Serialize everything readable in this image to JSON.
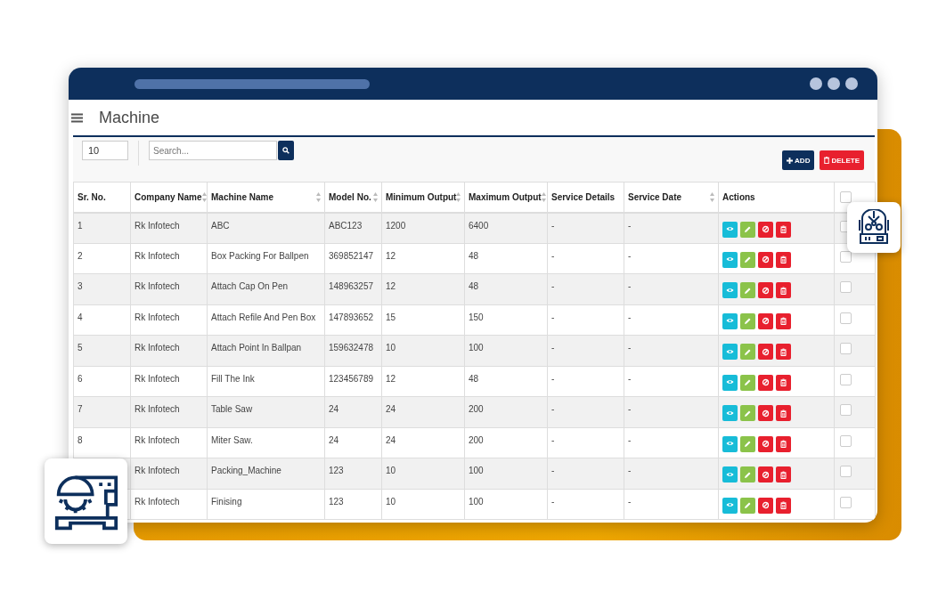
{
  "window": {
    "title": "Machine"
  },
  "toolbar": {
    "page_size": "10",
    "search": {
      "placeholder": "Search..."
    },
    "buttons": [
      {
        "label": "ADD",
        "kind": "add"
      },
      {
        "label": "DELETE",
        "kind": "delete"
      }
    ]
  },
  "table": {
    "columns": [
      {
        "label": "Sr. No.",
        "sortable": false
      },
      {
        "label": "Company Name",
        "sortable": true
      },
      {
        "label": "Machine Name",
        "sortable": true
      },
      {
        "label": "Model No.",
        "sortable": true
      },
      {
        "label": "Minimum Output",
        "sortable": true
      },
      {
        "label": "Maximum Output",
        "sortable": true
      },
      {
        "label": "Service Details",
        "sortable": false
      },
      {
        "label": "Service Date",
        "sortable": true
      },
      {
        "label": "Actions",
        "sortable": false
      }
    ],
    "select_all": {
      "checked": false
    },
    "rows": [
      {
        "sr_no": "1",
        "company": "Rk Infotech",
        "machine": "ABC",
        "model": "ABC123",
        "min_output": "1200",
        "max_output": "6400",
        "service_details": "-",
        "service_date": "-",
        "checked": false
      },
      {
        "sr_no": "2",
        "company": "Rk Infotech",
        "machine": "Box Packing For Ballpen",
        "model": "369852147",
        "min_output": "12",
        "max_output": "48",
        "service_details": "-",
        "service_date": "-",
        "checked": false
      },
      {
        "sr_no": "3",
        "company": "Rk Infotech",
        "machine": "Attach Cap On Pen",
        "model": "148963257",
        "min_output": "12",
        "max_output": "48",
        "service_details": "-",
        "service_date": "-",
        "checked": false
      },
      {
        "sr_no": "4",
        "company": "Rk Infotech",
        "machine": "Attach Refile And Pen Box",
        "model": "147893652",
        "min_output": "15",
        "max_output": "150",
        "service_details": "-",
        "service_date": "-",
        "checked": false
      },
      {
        "sr_no": "5",
        "company": "Rk Infotech",
        "machine": "Attach Point In Ballpan",
        "model": "159632478",
        "min_output": "10",
        "max_output": "100",
        "service_details": "-",
        "service_date": "-",
        "checked": false
      },
      {
        "sr_no": "6",
        "company": "Rk Infotech",
        "machine": "Fill The Ink",
        "model": "123456789",
        "min_output": "12",
        "max_output": "48",
        "service_details": "-",
        "service_date": "-",
        "checked": false
      },
      {
        "sr_no": "7",
        "company": "Rk Infotech",
        "machine": "Table Saw",
        "model": "24",
        "min_output": "24",
        "max_output": "200",
        "service_details": "-",
        "service_date": "-",
        "checked": false
      },
      {
        "sr_no": "8",
        "company": "Rk Infotech",
        "machine": "Miter Saw.",
        "model": "24",
        "min_output": "24",
        "max_output": "200",
        "service_details": "-",
        "service_date": "-",
        "checked": false
      },
      {
        "company": "Rk Infotech",
        "machine": "Packing_Machine",
        "model": "123",
        "min_output": "10",
        "max_output": "100",
        "service_details": "-",
        "service_date": "-",
        "checked": false
      },
      {
        "company": "Rk Infotech",
        "machine": "Finising",
        "model": "123",
        "min_output": "10",
        "max_output": "100",
        "service_details": "-",
        "service_date": "-",
        "checked": false
      }
    ]
  }
}
